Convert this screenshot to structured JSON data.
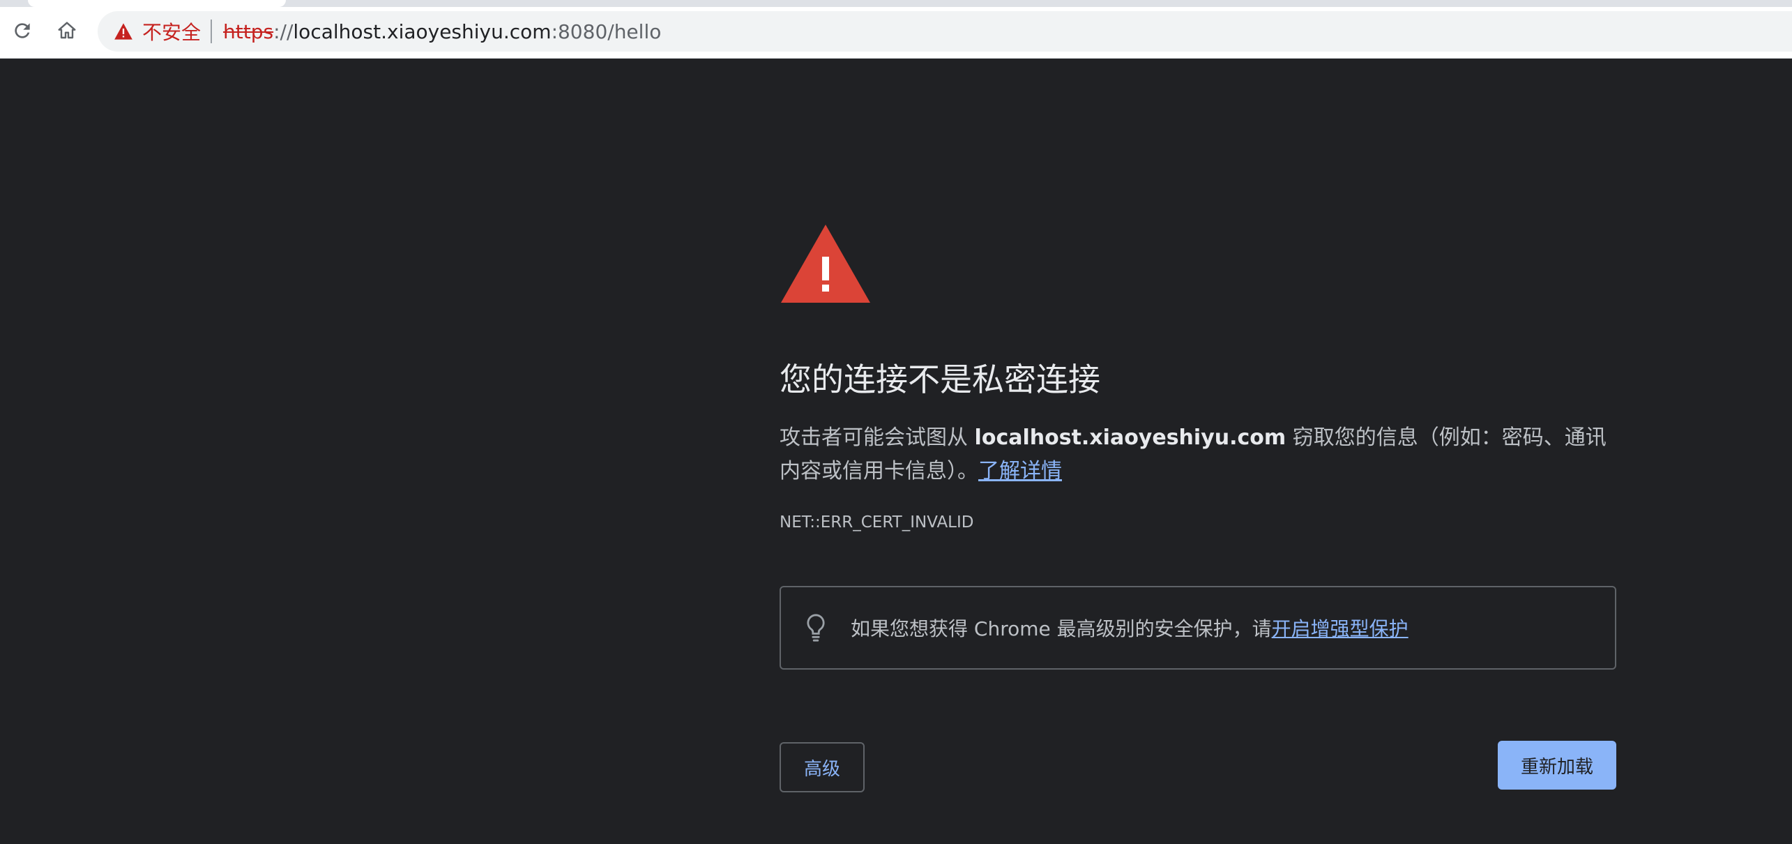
{
  "browser": {
    "security_label": "不安全",
    "url": {
      "scheme": "https",
      "separator": "://",
      "host": "localhost.xiaoyeshiyu.com",
      "port_path": ":8080/hello"
    },
    "icons": {
      "reload": "reload-icon",
      "home": "home-icon",
      "security": "warning-triangle-icon"
    }
  },
  "interstitial": {
    "heading": "您的连接不是私密连接",
    "explanation_prefix": "攻击者可能会试图从 ",
    "host": "localhost.xiaoyeshiyu.com",
    "explanation_suffix": " 窃取您的信息（例如：密码、通讯内容或信用卡信息）。",
    "learn_more": "了解详情",
    "error_code": "NET::ERR_CERT_INVALID",
    "enhanced_protection": {
      "text": "如果您想获得 Chrome 最高级别的安全保护，请",
      "link": "开启增强型保护"
    },
    "advanced_button": "高级",
    "reload_button": "重新加载"
  },
  "colors": {
    "page_background": "#202124",
    "warning_red": "#db4437",
    "link_blue": "#8ab4f8",
    "not_secure_red": "#c5221f"
  }
}
